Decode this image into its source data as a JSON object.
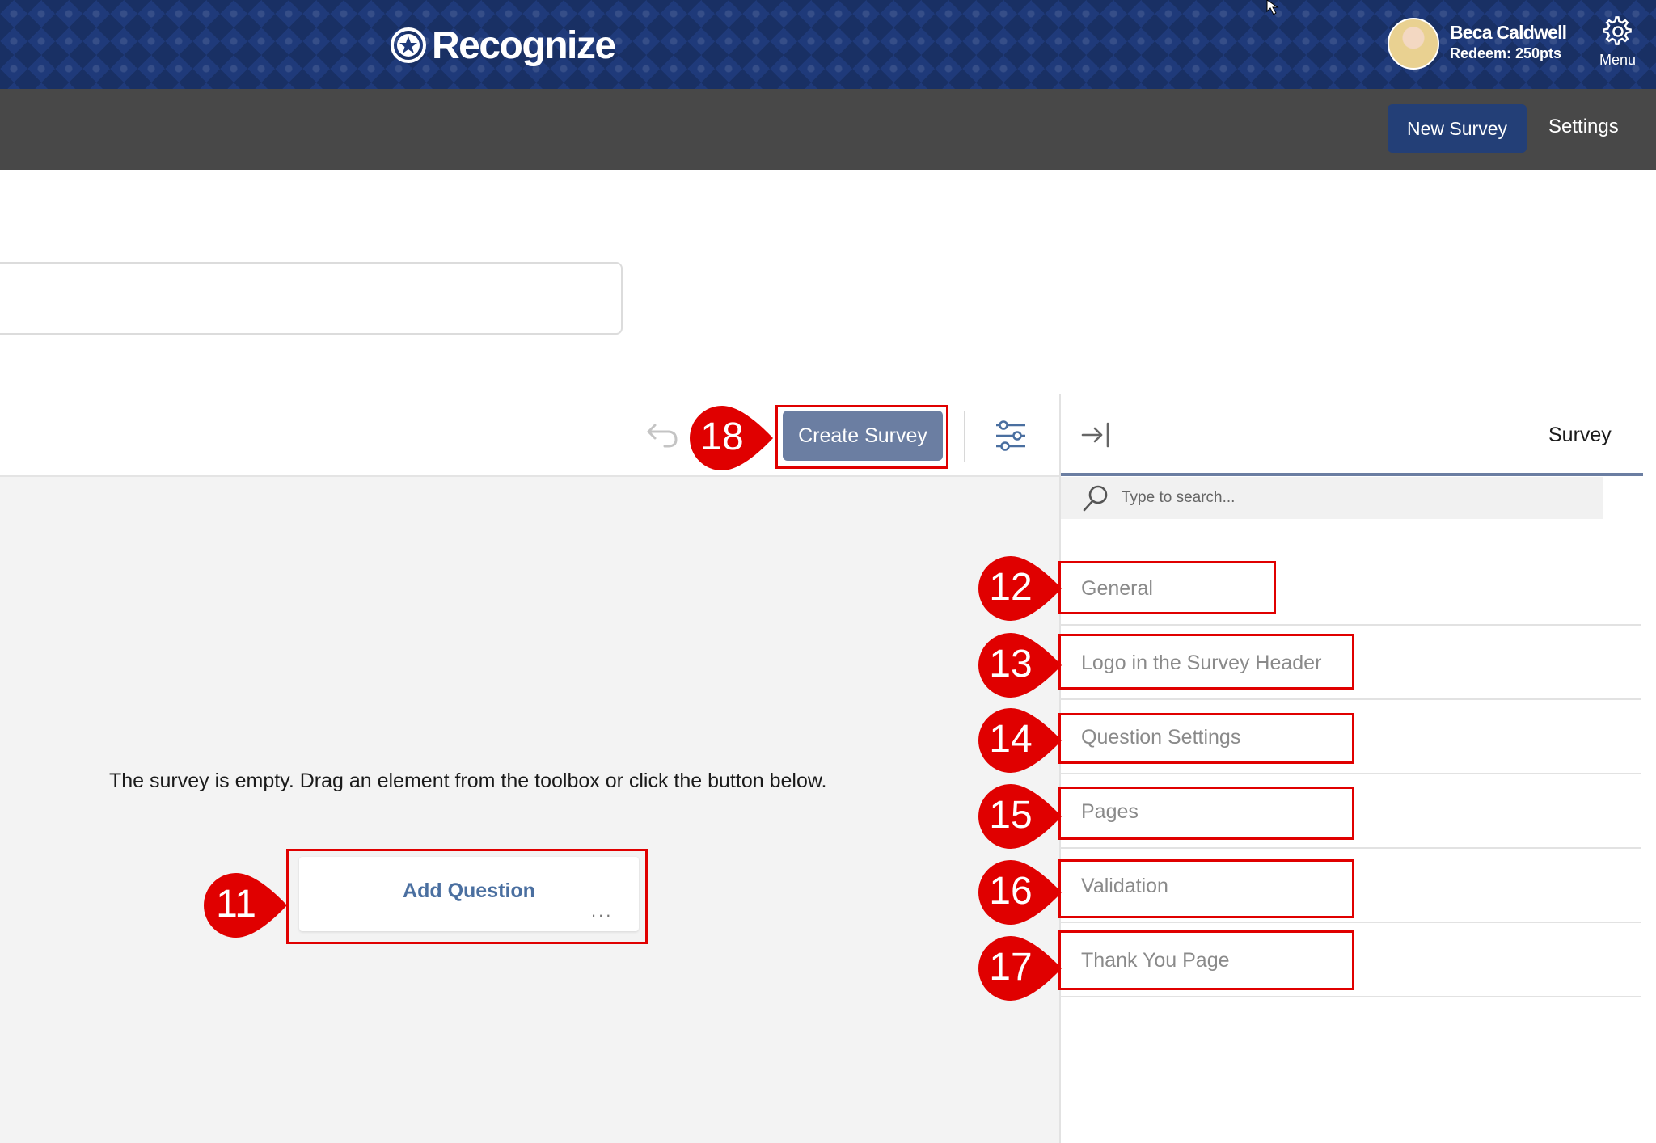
{
  "header": {
    "logo_text": "Recognize",
    "user_name": "Beca Caldwell",
    "user_points": "Redeem: 250pts",
    "menu_label": "Menu"
  },
  "subnav": {
    "new_survey_label": "New Survey",
    "settings_label": "Settings"
  },
  "toolbar": {
    "create_survey_label": "Create Survey"
  },
  "canvas": {
    "empty_message": "The survey is empty. Drag an element from the toolbox or click the button below.",
    "add_question_label": "Add Question",
    "more_label": "..."
  },
  "panel": {
    "tab_label": "Survey",
    "search_placeholder": "Type to search...",
    "categories": [
      {
        "label": "General"
      },
      {
        "label": "Logo in the Survey Header"
      },
      {
        "label": "Question Settings"
      },
      {
        "label": "Pages"
      },
      {
        "label": "Validation"
      },
      {
        "label": "Thank You Page"
      }
    ]
  },
  "callouts": {
    "add_question": "11",
    "general": "12",
    "logo_header": "13",
    "question_settings": "14",
    "pages": "15",
    "validation": "16",
    "thank_you": "17",
    "create_survey": "18"
  },
  "colors": {
    "header_blue": "#1f3a7a",
    "subnav_gray": "#484848",
    "primary_button": "#233f77",
    "create_button": "#6b7ea2",
    "callout_red": "#e00000",
    "link_blue": "#4a6fa0"
  }
}
